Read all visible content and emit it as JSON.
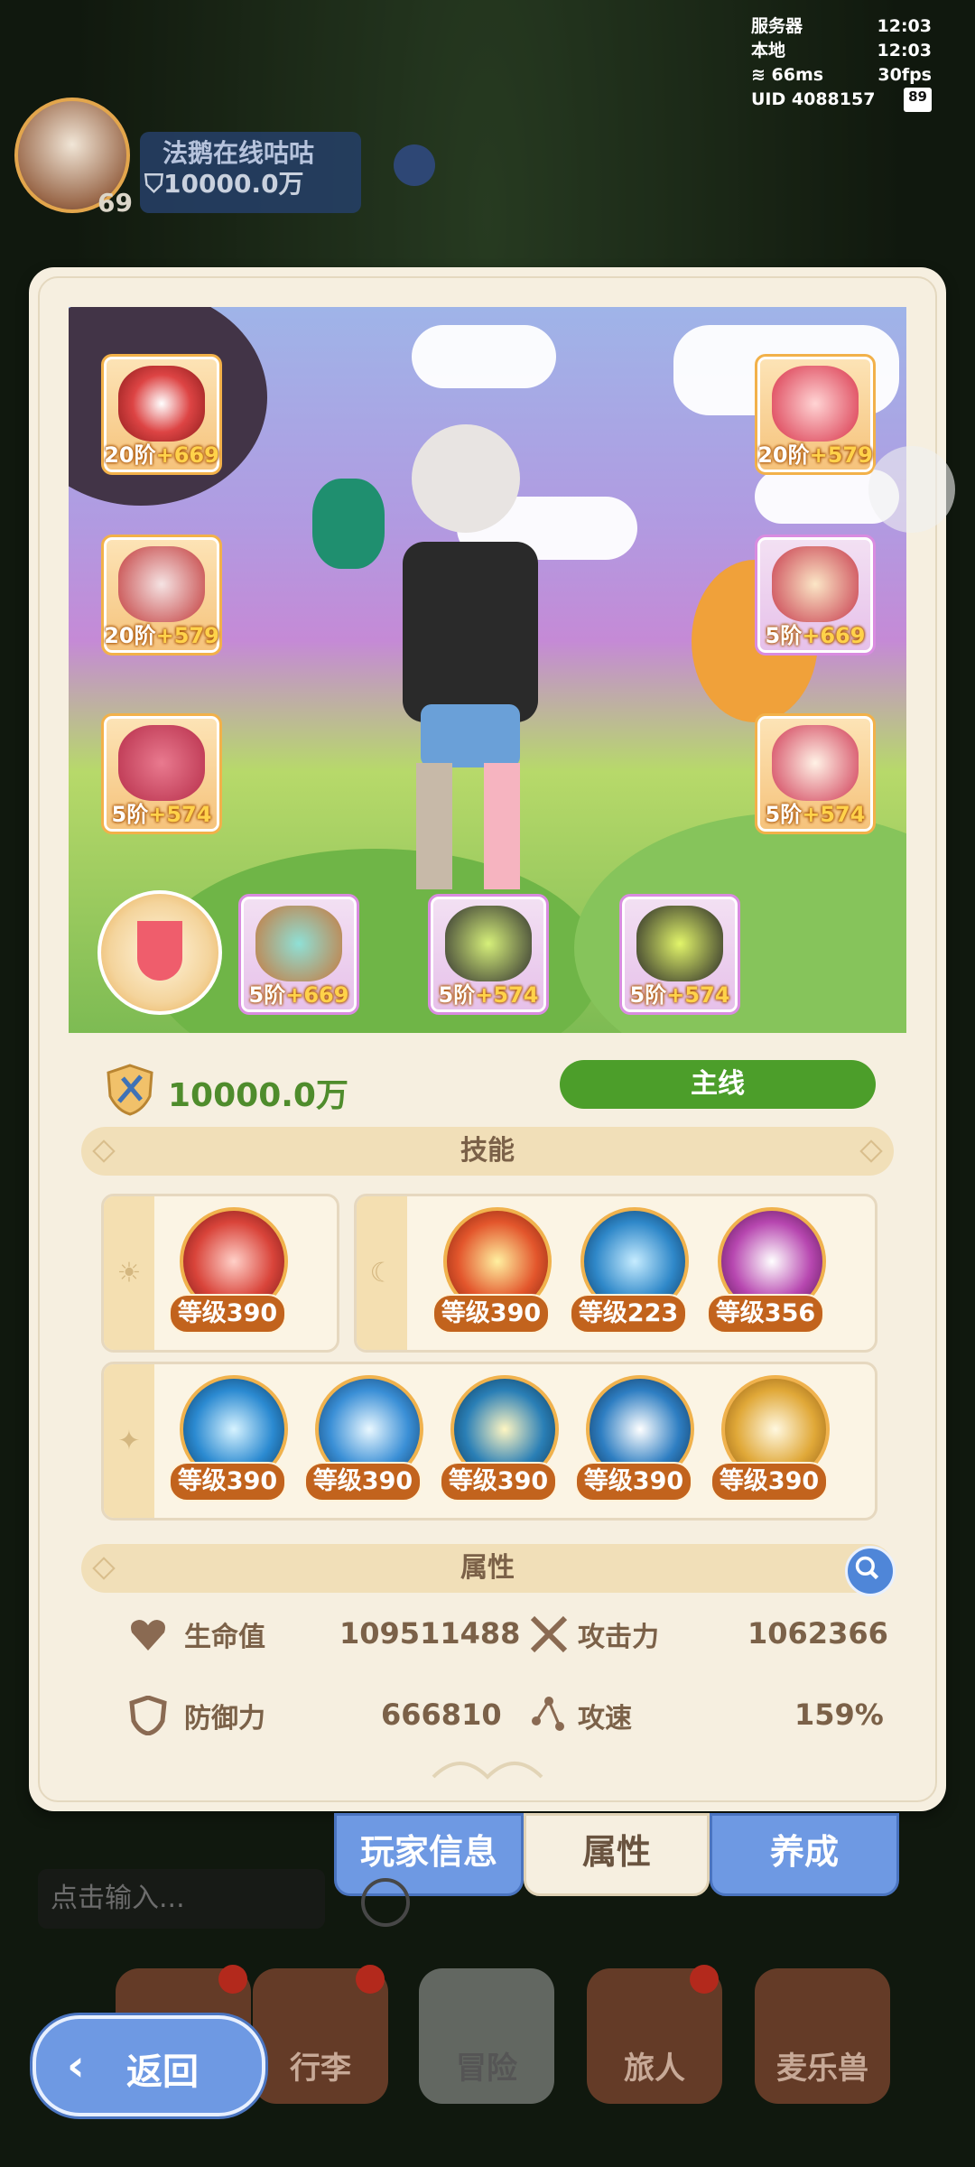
{
  "status": {
    "server_label": "服务器",
    "server_time": "12:03",
    "local_label": "本地",
    "local_time": "12:03",
    "ping": "66ms",
    "fps": "30fps",
    "uid": "UID 4088157",
    "battery": "89"
  },
  "player": {
    "level": "69",
    "name": "法鹅在线咕咕",
    "power": "10000.0万"
  },
  "equipment": [
    {
      "name": "helmet",
      "label_tier": "20阶",
      "label_plus": "+669",
      "rarity": "orange"
    },
    {
      "name": "armor",
      "label_tier": "20阶",
      "label_plus": "+579",
      "rarity": "orange"
    },
    {
      "name": "belt",
      "label_tier": "5阶",
      "label_plus": "+574",
      "rarity": "orange"
    },
    {
      "name": "mask",
      "label_tier": "20阶",
      "label_plus": "+579",
      "rarity": "orange"
    },
    {
      "name": "gloves",
      "label_tier": "5阶",
      "label_plus": "+669",
      "rarity": "purple"
    },
    {
      "name": "boots",
      "label_tier": "5阶",
      "label_plus": "+574",
      "rarity": "orange"
    },
    {
      "name": "ring",
      "label_tier": "5阶",
      "label_plus": "+669",
      "rarity": "purple"
    },
    {
      "name": "necklace",
      "label_tier": "5阶",
      "label_plus": "+574",
      "rarity": "purple"
    },
    {
      "name": "charm",
      "label_tier": "5阶",
      "label_plus": "+574",
      "rarity": "purple"
    }
  ],
  "summary": {
    "power": "10000.0万",
    "mainline_button": "主线"
  },
  "skills_section": {
    "title": "技能",
    "group_a": [
      {
        "level": "等级390",
        "color": "#d9443a"
      }
    ],
    "group_b": [
      {
        "level": "等级390",
        "color": "#e3562c"
      },
      {
        "level": "等级223",
        "color": "#2f88c9"
      },
      {
        "level": "等级356",
        "color": "#b747b0"
      }
    ],
    "group_c": [
      {
        "level": "等级390",
        "color": "#2b8ad1"
      },
      {
        "level": "等级390",
        "color": "#3a8fd6"
      },
      {
        "level": "等级390",
        "color": "#2a7fb6"
      },
      {
        "level": "等级390",
        "color": "#2e7ec2"
      },
      {
        "level": "等级390",
        "color": "#e0a838"
      }
    ]
  },
  "attributes": {
    "title": "属性",
    "hp_label": "生命值",
    "hp_value": "109511488",
    "atk_label": "攻击力",
    "atk_value": "1062366",
    "def_label": "防御力",
    "def_value": "666810",
    "spd_label": "攻速",
    "spd_value": "159%"
  },
  "tabs": [
    "玩家信息",
    "属性",
    "养成"
  ],
  "chat": {
    "placeholder": "点击输入..."
  },
  "nav": [
    "行李",
    "冒险",
    "旅人",
    "麦乐兽"
  ],
  "back_label": "返回",
  "colors": {
    "accent_green": "#4c9e2a",
    "tab_blue": "#6e99e3",
    "level_badge": "#c2631d"
  }
}
